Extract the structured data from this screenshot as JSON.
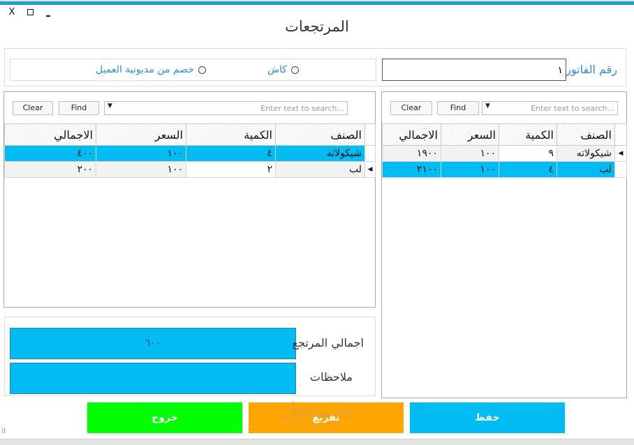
{
  "window": {
    "title": "المرتجعات",
    "controls": {
      "close": "X",
      "maximize": "□",
      "minimize": "_"
    }
  },
  "invoice": {
    "label": "رقم الفاتورة",
    "value": "١"
  },
  "payment_options": [
    {
      "label": "كاش",
      "selected": false
    },
    {
      "label": "خصم من مديونية العميل",
      "selected": false
    }
  ],
  "invoice_grid": {
    "search_placeholder": "Enter text to search...",
    "find_label": "Find",
    "clear_label": "Clear",
    "columns": [
      "الصنف",
      "الكمية",
      "السعر",
      "الاجمالي"
    ],
    "rows": [
      {
        "item": "شيكولاته",
        "qty": "٩",
        "price": "١٠٠",
        "total": "١٩٠٠",
        "current": true,
        "selected": false
      },
      {
        "item": "لب",
        "qty": "٤",
        "price": "١٠٠",
        "total": "٢١٠٠",
        "current": false,
        "selected": true
      }
    ]
  },
  "returns_grid": {
    "search_placeholder": "Enter text to search...",
    "find_label": "Find",
    "clear_label": "Clear",
    "columns": [
      "الصنف",
      "الكمية",
      "السعر",
      "الاجمالي"
    ],
    "rows": [
      {
        "item": "شيكولاته",
        "qty": "٤",
        "price": "١٠٠",
        "total": "٤٠٠",
        "current": false,
        "selected": true
      },
      {
        "item": "لب",
        "qty": "٢",
        "price": "١٠٠",
        "total": "٢٠٠",
        "current": true,
        "selected": false
      }
    ]
  },
  "totals": {
    "total_label": "اجمالي المرتجع",
    "total_value": "٦٠٠",
    "notes_label": "ملاحظات",
    "notes_value": ""
  },
  "actions": {
    "save": "حفظ",
    "clear": "تفريغ",
    "exit": "خروج"
  },
  "colors": {
    "accent_cyan": "#00bcf2",
    "save": "#00bcf2",
    "clear": "#ffa500",
    "exit": "#00ff00",
    "label_blue": "#2a8fd6"
  },
  "watermark": {
    "text": "مستقل",
    "sub": "mostaql.com"
  }
}
